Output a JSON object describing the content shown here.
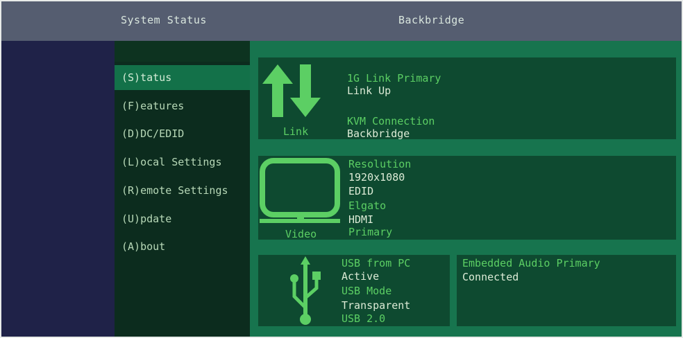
{
  "header": {
    "left_title": "System Status",
    "right_title": "Backbridge"
  },
  "nav": {
    "items": [
      {
        "label": "(S)tatus",
        "active": true
      },
      {
        "label": "(F)eatures"
      },
      {
        "label": "(D)DC/EDID"
      },
      {
        "label": "(L)ocal  Settings"
      },
      {
        "label": "(R)emote Settings"
      },
      {
        "label": "(U)pdate"
      },
      {
        "label": "(A)bout"
      }
    ]
  },
  "link_panel": {
    "caption": "Link",
    "rows": [
      {
        "label": "1G Link Primary",
        "value": "Link Up"
      },
      {
        "label": "KVM Connection",
        "value": "Backbridge"
      }
    ]
  },
  "video_panel": {
    "caption": "Video",
    "rows": [
      {
        "label": "Resolution",
        "value": "1920x1080"
      },
      {
        "label": "EDID",
        "value": "Elgato"
      },
      {
        "label": "HDMI",
        "value": "Primary"
      }
    ]
  },
  "usb_panel": {
    "rows": [
      {
        "label": "USB from PC",
        "value": "Active"
      },
      {
        "label": "USB Mode",
        "value": "Transparent"
      },
      {
        "label": "USB 2.0"
      }
    ]
  },
  "audio_panel": {
    "label": "Embedded Audio Primary",
    "value": "Connected"
  },
  "colors": {
    "accent": "#5ccf64",
    "panel": "#0e4a30",
    "content_bg": "#17744e",
    "header_bg": "#555d70",
    "sidebar_bg": "#1f2248"
  },
  "icons": [
    "link-arrows-icon",
    "monitor-icon",
    "usb-icon"
  ]
}
